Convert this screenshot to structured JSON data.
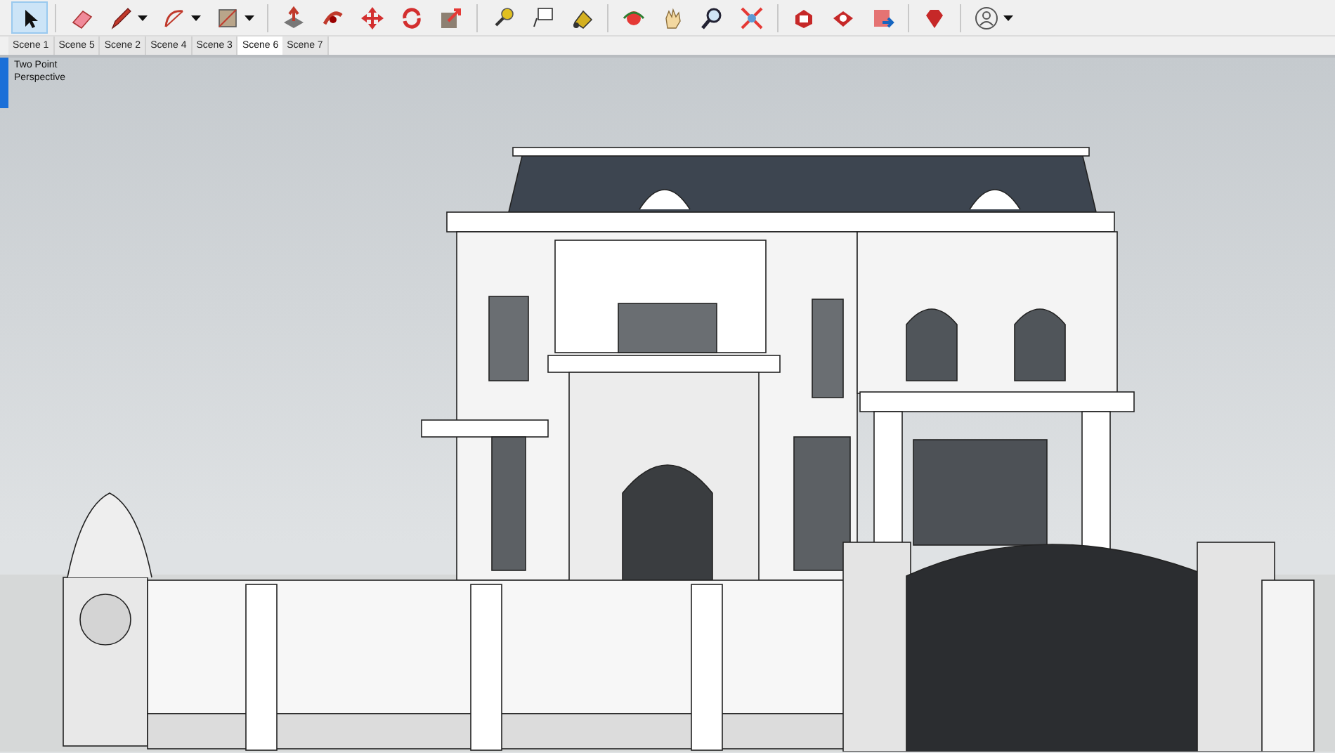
{
  "toolbar": {
    "groups": [
      [
        {
          "selected": true,
          "dropdown": false
        }
      ],
      [
        {
          "selected": false,
          "dropdown": false
        },
        {
          "selected": false,
          "dropdown": true
        },
        {
          "selected": false,
          "dropdown": true
        },
        {
          "selected": false,
          "dropdown": true
        }
      ],
      [
        {
          "selected": false,
          "dropdown": false
        },
        {
          "selected": false,
          "dropdown": false
        },
        {
          "selected": false,
          "dropdown": false
        },
        {
          "selected": false,
          "dropdown": false
        },
        {
          "selected": false,
          "dropdown": false
        }
      ],
      [
        {
          "selected": false,
          "dropdown": false
        },
        {
          "selected": false,
          "dropdown": false
        },
        {
          "selected": false,
          "dropdown": false
        }
      ],
      [
        {
          "selected": false,
          "dropdown": false
        },
        {
          "selected": false,
          "dropdown": false
        },
        {
          "selected": false,
          "dropdown": false
        },
        {
          "selected": false,
          "dropdown": false
        }
      ],
      [
        {
          "selected": false,
          "dropdown": false
        },
        {
          "selected": false,
          "dropdown": false
        },
        {
          "selected": false,
          "dropdown": false
        }
      ],
      [
        {
          "selected": false,
          "dropdown": false
        }
      ],
      [
        {
          "selected": false,
          "dropdown": true
        }
      ]
    ]
  },
  "scene_tabs": [
    {
      "label": "Scene 1",
      "selected": false
    },
    {
      "label": "Scene 5",
      "selected": false
    },
    {
      "label": "Scene 2",
      "selected": false
    },
    {
      "label": "Scene 4",
      "selected": false
    },
    {
      "label": "Scene 3",
      "selected": false
    },
    {
      "label": "Scene 6",
      "selected": true
    },
    {
      "label": "Scene 7",
      "selected": false
    }
  ],
  "viewport": {
    "camera_label": "Two Point Perspective"
  }
}
